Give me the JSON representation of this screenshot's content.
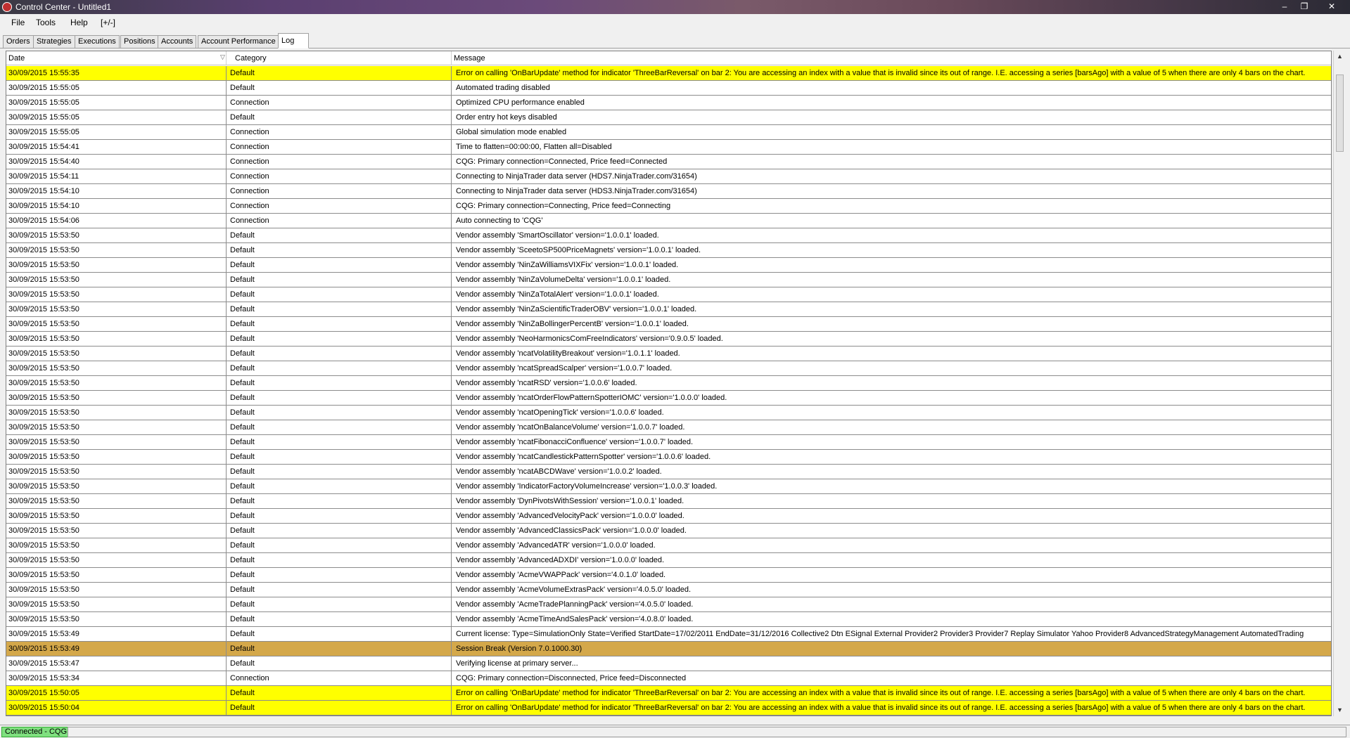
{
  "window": {
    "title": "Control Center - Untitled1",
    "minimize": "‒",
    "restore": "❐",
    "close": "✕"
  },
  "menu": {
    "file": "File",
    "tools": "Tools",
    "help": "Help",
    "plusminus": "[+/-]"
  },
  "tabs": [
    "Orders",
    "Strategies",
    "Executions",
    "Positions",
    "Accounts",
    "Account Performance",
    "Log"
  ],
  "active_tab": "Log",
  "columns": {
    "date": "Date",
    "category": "Category",
    "message": "Message"
  },
  "rows": [
    {
      "date": "30/09/2015 15:55:35",
      "category": "Default",
      "message": "Error on calling 'OnBarUpdate' method for indicator 'ThreeBarReversal' on bar 2: You are accessing an index with a value that is invalid since its out of range. I.E. accessing a series [barsAgo] with a value of 5 when there are only 4 bars on the chart.",
      "style": "err"
    },
    {
      "date": "30/09/2015 15:55:05",
      "category": "Default",
      "message": "Automated trading disabled",
      "style": ""
    },
    {
      "date": "30/09/2015 15:55:05",
      "category": "Connection",
      "message": "Optimized CPU performance enabled",
      "style": ""
    },
    {
      "date": "30/09/2015 15:55:05",
      "category": "Default",
      "message": "Order entry hot keys disabled",
      "style": ""
    },
    {
      "date": "30/09/2015 15:55:05",
      "category": "Connection",
      "message": "Global simulation mode enabled",
      "style": ""
    },
    {
      "date": "30/09/2015 15:54:41",
      "category": "Connection",
      "message": "Time to flatten=00:00:00, Flatten all=Disabled",
      "style": ""
    },
    {
      "date": "30/09/2015 15:54:40",
      "category": "Connection",
      "message": "CQG: Primary connection=Connected, Price feed=Connected",
      "style": ""
    },
    {
      "date": "30/09/2015 15:54:11",
      "category": "Connection",
      "message": "Connecting to NinjaTrader data server (HDS7.NinjaTrader.com/31654)",
      "style": ""
    },
    {
      "date": "30/09/2015 15:54:10",
      "category": "Connection",
      "message": "Connecting to NinjaTrader data server (HDS3.NinjaTrader.com/31654)",
      "style": ""
    },
    {
      "date": "30/09/2015 15:54:10",
      "category": "Connection",
      "message": "CQG: Primary connection=Connecting, Price feed=Connecting",
      "style": ""
    },
    {
      "date": "30/09/2015 15:54:06",
      "category": "Connection",
      "message": "Auto connecting to 'CQG'",
      "style": ""
    },
    {
      "date": "30/09/2015 15:53:50",
      "category": "Default",
      "message": "Vendor assembly 'SmartOscillator' version='1.0.0.1' loaded.",
      "style": ""
    },
    {
      "date": "30/09/2015 15:53:50",
      "category": "Default",
      "message": "Vendor assembly 'SceetoSP500PriceMagnets' version='1.0.0.1' loaded.",
      "style": ""
    },
    {
      "date": "30/09/2015 15:53:50",
      "category": "Default",
      "message": "Vendor assembly 'NinZaWilliamsVIXFix' version='1.0.0.1' loaded.",
      "style": ""
    },
    {
      "date": "30/09/2015 15:53:50",
      "category": "Default",
      "message": "Vendor assembly 'NinZaVolumeDelta' version='1.0.0.1' loaded.",
      "style": ""
    },
    {
      "date": "30/09/2015 15:53:50",
      "category": "Default",
      "message": "Vendor assembly 'NinZaTotalAlert' version='1.0.0.1' loaded.",
      "style": ""
    },
    {
      "date": "30/09/2015 15:53:50",
      "category": "Default",
      "message": "Vendor assembly 'NinZaScientificTraderOBV' version='1.0.0.1' loaded.",
      "style": ""
    },
    {
      "date": "30/09/2015 15:53:50",
      "category": "Default",
      "message": "Vendor assembly 'NinZaBollingerPercentB' version='1.0.0.1' loaded.",
      "style": ""
    },
    {
      "date": "30/09/2015 15:53:50",
      "category": "Default",
      "message": "Vendor assembly 'NeoHarmonicsComFreeIndicators' version='0.9.0.5' loaded.",
      "style": ""
    },
    {
      "date": "30/09/2015 15:53:50",
      "category": "Default",
      "message": "Vendor assembly 'ncatVolatilityBreakout' version='1.0.1.1' loaded.",
      "style": ""
    },
    {
      "date": "30/09/2015 15:53:50",
      "category": "Default",
      "message": "Vendor assembly 'ncatSpreadScalper' version='1.0.0.7' loaded.",
      "style": ""
    },
    {
      "date": "30/09/2015 15:53:50",
      "category": "Default",
      "message": "Vendor assembly 'ncatRSD' version='1.0.0.6' loaded.",
      "style": ""
    },
    {
      "date": "30/09/2015 15:53:50",
      "category": "Default",
      "message": "Vendor assembly 'ncatOrderFlowPatternSpotterIOMC' version='1.0.0.0' loaded.",
      "style": ""
    },
    {
      "date": "30/09/2015 15:53:50",
      "category": "Default",
      "message": "Vendor assembly 'ncatOpeningTick' version='1.0.0.6' loaded.",
      "style": ""
    },
    {
      "date": "30/09/2015 15:53:50",
      "category": "Default",
      "message": "Vendor assembly 'ncatOnBalanceVolume' version='1.0.0.7' loaded.",
      "style": ""
    },
    {
      "date": "30/09/2015 15:53:50",
      "category": "Default",
      "message": "Vendor assembly 'ncatFibonacciConfluence' version='1.0.0.7' loaded.",
      "style": ""
    },
    {
      "date": "30/09/2015 15:53:50",
      "category": "Default",
      "message": "Vendor assembly 'ncatCandlestickPatternSpotter' version='1.0.0.6' loaded.",
      "style": ""
    },
    {
      "date": "30/09/2015 15:53:50",
      "category": "Default",
      "message": "Vendor assembly 'ncatABCDWave' version='1.0.0.2' loaded.",
      "style": ""
    },
    {
      "date": "30/09/2015 15:53:50",
      "category": "Default",
      "message": "Vendor assembly 'IndicatorFactoryVolumeIncrease' version='1.0.0.3' loaded.",
      "style": ""
    },
    {
      "date": "30/09/2015 15:53:50",
      "category": "Default",
      "message": "Vendor assembly 'DynPivotsWithSession' version='1.0.0.1' loaded.",
      "style": ""
    },
    {
      "date": "30/09/2015 15:53:50",
      "category": "Default",
      "message": "Vendor assembly 'AdvancedVelocityPack' version='1.0.0.0' loaded.",
      "style": ""
    },
    {
      "date": "30/09/2015 15:53:50",
      "category": "Default",
      "message": "Vendor assembly 'AdvancedClassicsPack' version='1.0.0.0' loaded.",
      "style": ""
    },
    {
      "date": "30/09/2015 15:53:50",
      "category": "Default",
      "message": "Vendor assembly 'AdvancedATR' version='1.0.0.0' loaded.",
      "style": ""
    },
    {
      "date": "30/09/2015 15:53:50",
      "category": "Default",
      "message": "Vendor assembly 'AdvancedADXDI' version='1.0.0.0' loaded.",
      "style": ""
    },
    {
      "date": "30/09/2015 15:53:50",
      "category": "Default",
      "message": "Vendor assembly 'AcmeVWAPPack' version='4.0.1.0' loaded.",
      "style": ""
    },
    {
      "date": "30/09/2015 15:53:50",
      "category": "Default",
      "message": "Vendor assembly 'AcmeVolumeExtrasPack' version='4.0.5.0' loaded.",
      "style": ""
    },
    {
      "date": "30/09/2015 15:53:50",
      "category": "Default",
      "message": "Vendor assembly 'AcmeTradePlanningPack' version='4.0.5.0' loaded.",
      "style": ""
    },
    {
      "date": "30/09/2015 15:53:50",
      "category": "Default",
      "message": "Vendor assembly 'AcmeTimeAndSalesPack' version='4.0.8.0' loaded.",
      "style": ""
    },
    {
      "date": "30/09/2015 15:53:49",
      "category": "Default",
      "message": "Current license: Type=SimulationOnly State=Verified StartDate=17/02/2011 EndDate=31/12/2016 Collective2 Dtn ESignal External Provider2 Provider3 Provider7 Replay Simulator Yahoo Provider8 AdvancedStrategyManagement AutomatedTrading",
      "style": ""
    },
    {
      "date": "30/09/2015 15:53:49",
      "category": "Default",
      "message": "Session Break (Version 7.0.1000.30)",
      "style": "brk"
    },
    {
      "date": "30/09/2015 15:53:47",
      "category": "Default",
      "message": "Verifying license at primary server...",
      "style": ""
    },
    {
      "date": "30/09/2015 15:53:34",
      "category": "Connection",
      "message": "CQG: Primary connection=Disconnected, Price feed=Disconnected",
      "style": ""
    },
    {
      "date": "30/09/2015 15:50:05",
      "category": "Default",
      "message": "Error on calling 'OnBarUpdate' method for indicator 'ThreeBarReversal' on bar 2: You are accessing an index with a value that is invalid since its out of range. I.E. accessing a series [barsAgo] with a value of 5 when there are only 4 bars on the chart.",
      "style": "err"
    },
    {
      "date": "30/09/2015 15:50:04",
      "category": "Default",
      "message": "Error on calling 'OnBarUpdate' method for indicator 'ThreeBarReversal' on bar 2: You are accessing an index with a value that is invalid since its out of range. I.E. accessing a series [barsAgo] with a value of 5 when there are only 4 bars on the chart.",
      "style": "err"
    }
  ],
  "status": {
    "connection": "Connected - CQG"
  },
  "colors": {
    "error_row": "#ffff00",
    "session_break_row": "#d4a84a",
    "connected": "#7fe07f"
  }
}
